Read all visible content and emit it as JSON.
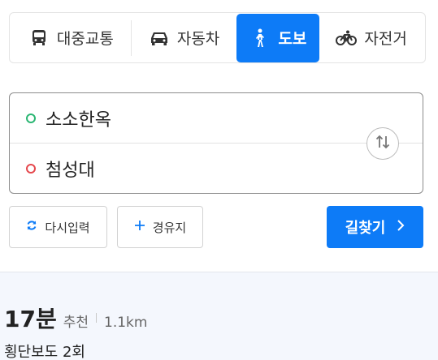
{
  "modes": {
    "transit": {
      "label": "대중교통",
      "icon": "bus-icon"
    },
    "car": {
      "label": "자동차",
      "icon": "car-icon"
    },
    "walk": {
      "label": "도보",
      "icon": "walking-person-icon"
    },
    "bike": {
      "label": "자전거",
      "icon": "bicycle-icon"
    },
    "selected": "walk"
  },
  "route": {
    "origin": "소소한옥",
    "destination": "첨성대"
  },
  "actions": {
    "reset_label": "다시입력",
    "waypoint_label": "경유지",
    "search_label": "길찾기"
  },
  "result": {
    "duration": "17분",
    "tag": "추천",
    "distance": "1.1km",
    "summary": "횡단보도 2회"
  },
  "colors": {
    "accent": "#0d7bf7",
    "origin_dot": "#2bb673",
    "destination_dot": "#e5484d",
    "result_bg": "#f4f7fd"
  }
}
